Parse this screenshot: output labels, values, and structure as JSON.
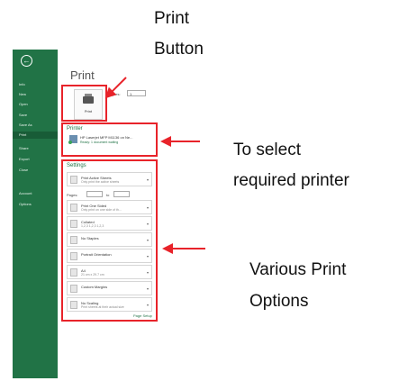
{
  "annotations": {
    "print_button": [
      "Print",
      "Button"
    ],
    "select_printer": [
      "To select",
      "required printer"
    ],
    "print_options": [
      "Various Print",
      "Options"
    ]
  },
  "sidebar": {
    "back_icon": "back-arrow-icon",
    "items": [
      {
        "label": "Info",
        "active": false
      },
      {
        "label": "New",
        "active": false
      },
      {
        "label": "Open",
        "active": false
      },
      {
        "label": "Save",
        "active": false
      },
      {
        "label": "Save As",
        "active": false
      },
      {
        "label": "Print",
        "active": true
      },
      {
        "label": "Share",
        "active": false
      },
      {
        "label": "Export",
        "active": false
      },
      {
        "label": "Close",
        "active": false
      },
      {
        "label": "Account",
        "active": false
      },
      {
        "label": "Options",
        "active": false
      }
    ]
  },
  "print_panel": {
    "title": "Print",
    "copies_label": "Copies:",
    "copies_value": "1",
    "print_button_label": "Print",
    "printer_heading": "Printer",
    "printer_name": "HP Laserjet MFP M1136 on Ne...",
    "printer_status": "Ready: 1 document waiting",
    "settings_heading": "Settings",
    "pages_label": "Pages:",
    "pages_to": "to",
    "page_setup_link": "Page Setup",
    "options": [
      {
        "title": "Print Active Sheets",
        "sub": "Only print the active sheets",
        "icon": "sheets-icon"
      },
      {
        "title": "Print One Sided",
        "sub": "Only print on one side of th...",
        "icon": "one-sided-icon"
      },
      {
        "title": "Collated",
        "sub": "1,2,3  1,2,3  1,2,3",
        "icon": "collated-icon"
      },
      {
        "title": "No Staples",
        "sub": "",
        "icon": "staple-icon"
      },
      {
        "title": "Portrait Orientation",
        "sub": "",
        "icon": "portrait-icon"
      },
      {
        "title": "A4",
        "sub": "21 cm x 29.7 cm",
        "icon": "paper-size-icon"
      },
      {
        "title": "Custom Margins",
        "sub": "",
        "icon": "margins-icon"
      },
      {
        "title": "No Scaling",
        "sub": "Print sheets at their actual size",
        "icon": "scaling-icon"
      }
    ]
  },
  "colors": {
    "sidebar": "#217346",
    "highlight": "#e8232a",
    "accent": "#217346"
  }
}
